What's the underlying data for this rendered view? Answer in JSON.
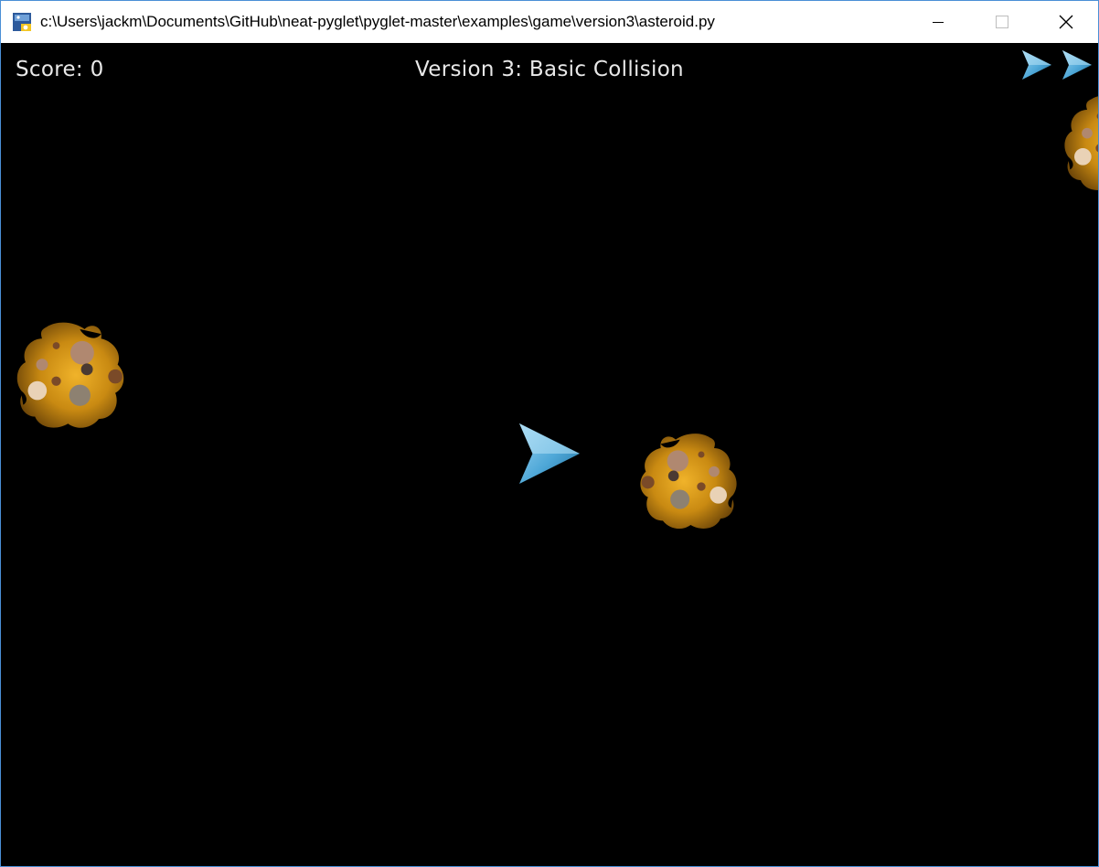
{
  "window": {
    "title": "c:\\Users\\jackm\\Documents\\GitHub\\neat-pyglet\\pyglet-master\\examples\\game\\version3\\asteroid.py",
    "icon": "python-icon",
    "controls": [
      "minimize-icon",
      "maximize-icon",
      "close-icon"
    ]
  },
  "hud": {
    "score_label": "Score: 0",
    "level_title": "Version 3: Basic Collision"
  },
  "game": {
    "background_color": "#000000",
    "lives_remaining": 2,
    "entities": [
      {
        "type": "player-ship",
        "icon": "ship-icon"
      },
      {
        "type": "asteroid",
        "icon": "asteroid-icon"
      },
      {
        "type": "asteroid",
        "icon": "asteroid-icon"
      },
      {
        "type": "asteroid",
        "icon": "asteroid-icon"
      }
    ]
  },
  "colors": {
    "ship": "#4fa8d8",
    "asteroid": "#c98a12",
    "hud_text": "#e8e8e8",
    "window_border": "#4a8fd6"
  }
}
